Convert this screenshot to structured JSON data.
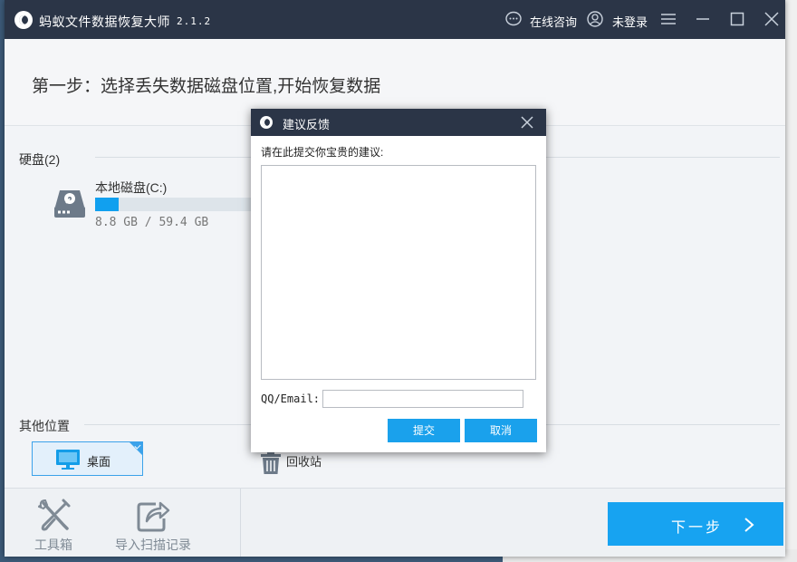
{
  "app": {
    "title": "蚂蚁文件数据恢复大师",
    "version": "2.1.2",
    "online_consult": "在线咨询",
    "login_status": "未登录"
  },
  "step": {
    "title": "第一步：选择丢失数据磁盘位置,开始恢复数据"
  },
  "disks": {
    "label": "硬盘(2)",
    "items": [
      {
        "name": "本地磁盘(C:)",
        "size_text": "8.8 GB / 59.4 GB",
        "used_fraction": 0.148
      }
    ]
  },
  "other_locations": {
    "label": "其他位置",
    "items": [
      {
        "name": "桌面",
        "selected": true
      },
      {
        "name": "回收站",
        "selected": false
      }
    ]
  },
  "footer": {
    "tools": [
      {
        "label": "工具箱",
        "icon": "toolbox-icon"
      },
      {
        "label": "导入扫描记录",
        "icon": "import-record-icon"
      }
    ],
    "next_label": "下一步"
  },
  "dialog": {
    "title": "建议反馈",
    "prompt": "请在此提交你宝贵的建议:",
    "feedback_value": "",
    "contact_label": "QQ/Email:",
    "contact_value": "",
    "submit_label": "提交",
    "cancel_label": "取消"
  },
  "colors": {
    "titlebar": "#2b3547",
    "accent": "#17a3f1",
    "selected_bg": "#e3f0fb"
  }
}
